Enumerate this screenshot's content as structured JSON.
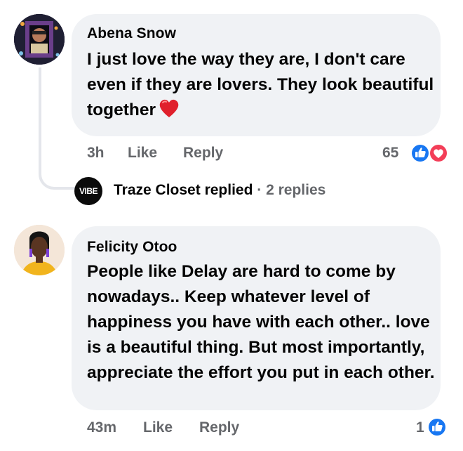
{
  "comments": [
    {
      "author": "Abena Snow",
      "text": "I just love the way they are, I don't care even if they are lovers. They look beautiful together",
      "time": "3h",
      "like_label": "Like",
      "reply_label": "Reply",
      "reaction_count": "65",
      "reactions": [
        "like-icon",
        "love-icon"
      ],
      "inline_emoji": "red-heart-emoji"
    },
    {
      "author": "Felicity Otoo",
      "text": "People like Delay are hard to come by nowadays.. Keep whatever level of happiness you have with each other.. love is a beautiful thing. But most importantly, appreciate the effort you put in each other.",
      "time": "43m",
      "like_label": "Like",
      "reply_label": "Reply",
      "reaction_count": "1",
      "reactions": [
        "like-icon"
      ]
    }
  ],
  "reply_summary": {
    "avatar_text": "VIBE",
    "name": "Traze Closet",
    "action": "replied",
    "separator": "·",
    "count": "2 replies"
  },
  "colors": {
    "bubble": "#f0f2f5",
    "meta_text": "#65676b",
    "like_blue": "#1877f2",
    "love_red": "#f33e58"
  }
}
